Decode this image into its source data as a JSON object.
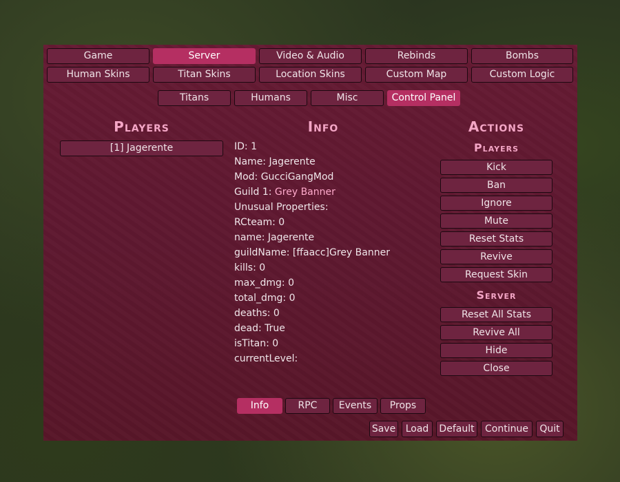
{
  "top_tabs_row1": [
    {
      "label": "Game",
      "active": false
    },
    {
      "label": "Server",
      "active": true
    },
    {
      "label": "Video & Audio",
      "active": false
    },
    {
      "label": "Rebinds",
      "active": false
    },
    {
      "label": "Bombs",
      "active": false
    }
  ],
  "top_tabs_row2": [
    {
      "label": "Human Skins",
      "active": false
    },
    {
      "label": "Titan Skins",
      "active": false
    },
    {
      "label": "Location Skins",
      "active": false
    },
    {
      "label": "Custom Map",
      "active": false
    },
    {
      "label": "Custom Logic",
      "active": false
    }
  ],
  "sub_tabs": [
    {
      "label": "Titans",
      "active": false
    },
    {
      "label": "Humans",
      "active": false
    },
    {
      "label": "Misc",
      "active": false
    },
    {
      "label": "Control Panel",
      "active": true
    }
  ],
  "players": {
    "title": "Players",
    "items": [
      "[1] Jagerente"
    ]
  },
  "info": {
    "title": "Info",
    "lines": {
      "id": "ID: 1",
      "name": "Name: Jagerente",
      "mod": "Mod: GucciGangMod",
      "guild_label": "Guild 1: ",
      "guild_value": "Grey Banner",
      "unusual": "Unusual Properties:",
      "rcteam": "RCteam: 0",
      "name_prop": "name: Jagerente",
      "guildname": "guildName: [ffaacc]Grey Banner",
      "kills": "kills: 0",
      "max_dmg": "max_dmg: 0",
      "total_dmg": "total_dmg: 0",
      "deaths": "deaths: 0",
      "dead": "dead: True",
      "istitan": "isTitan: 0",
      "currentlevel": "currentLevel:"
    }
  },
  "actions": {
    "title": "Actions",
    "players_title": "Players",
    "player_buttons": [
      "Kick",
      "Ban",
      "Ignore",
      "Mute",
      "Reset Stats",
      "Revive",
      "Request Skin"
    ],
    "server_title": "Server",
    "server_buttons": [
      "Reset All Stats",
      "Revive All",
      "Hide",
      "Close"
    ]
  },
  "bottom_tabs": [
    {
      "label": "Info",
      "active": true
    },
    {
      "label": "RPC",
      "active": false
    },
    {
      "label": "Events",
      "active": false
    },
    {
      "label": "Props",
      "active": false
    }
  ],
  "footer_buttons": {
    "save": "Save",
    "load": "Load",
    "default": "Default",
    "continue": "Continue",
    "quit": "Quit"
  },
  "colors": {
    "accent": "#b52f62",
    "heading": "#f4a6c6",
    "guild": "#ffaacc"
  }
}
